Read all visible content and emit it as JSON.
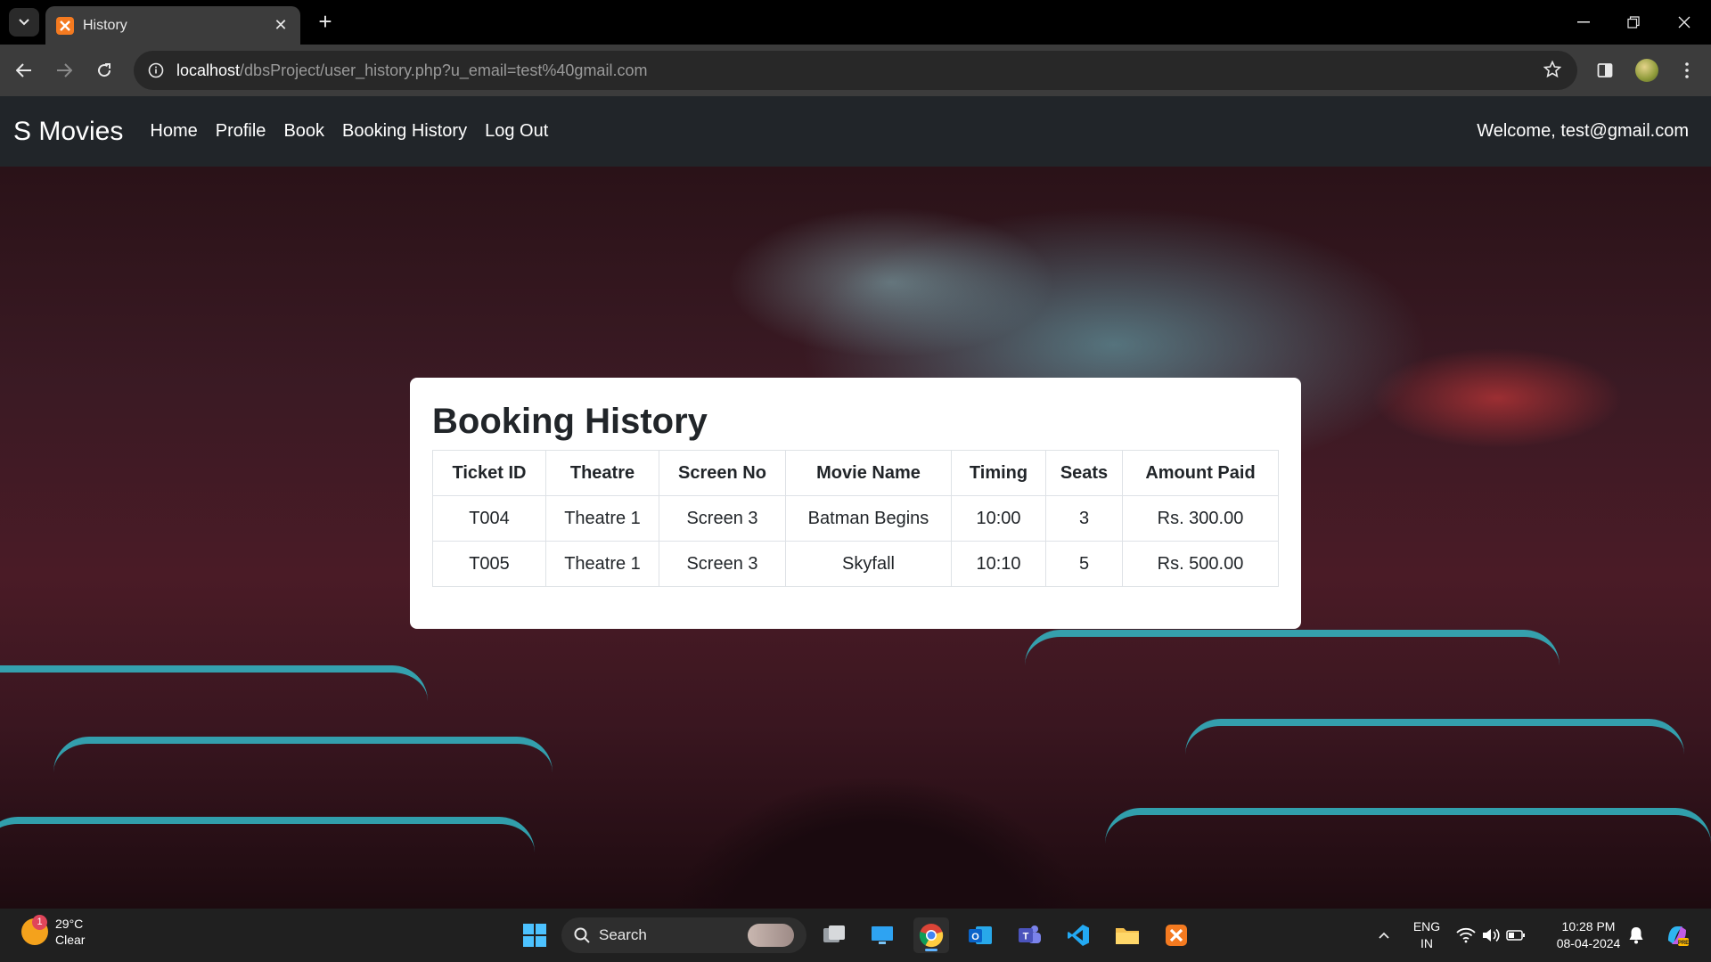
{
  "browser": {
    "tab_title": "History",
    "url_host": "localhost",
    "url_path": "/dbsProject/user_history.php?u_email=test%40gmail.com"
  },
  "site": {
    "brand": "S Movies",
    "nav": [
      "Home",
      "Profile",
      "Book",
      "Booking History",
      "Log Out"
    ],
    "welcome": "Welcome, test@gmail.com"
  },
  "history": {
    "title": "Booking History",
    "columns": [
      "Ticket ID",
      "Theatre",
      "Screen No",
      "Movie Name",
      "Timing",
      "Seats",
      "Amount Paid"
    ],
    "rows": [
      [
        "T004",
        "Theatre 1",
        "Screen 3",
        "Batman Begins",
        "10:00",
        "3",
        "Rs. 300.00"
      ],
      [
        "T005",
        "Theatre 1",
        "Screen 3",
        "Skyfall",
        "10:10",
        "5",
        "Rs. 500.00"
      ]
    ]
  },
  "taskbar": {
    "weather_temp": "29°C",
    "weather_cond": "Clear",
    "weather_badge": "1",
    "search_label": "Search",
    "lang_1": "ENG",
    "lang_2": "IN",
    "time": "10:28 PM",
    "date": "08-04-2024"
  },
  "colors": {
    "site_navbar": "#212529",
    "card_bg": "#ffffff",
    "accent_teal": "#33b8c6"
  }
}
